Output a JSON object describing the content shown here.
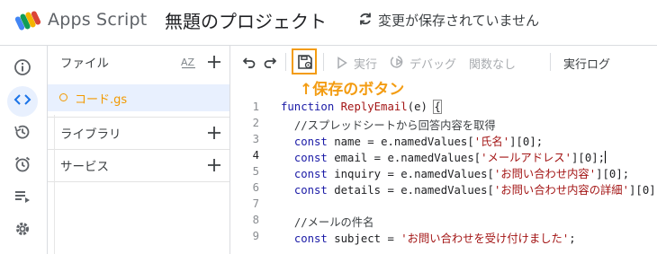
{
  "header": {
    "app_name": "Apps Script",
    "project_title": "無題のプロジェクト",
    "save_status": "変更が保存されていません"
  },
  "rail": {
    "items": [
      {
        "name": "overview-icon"
      },
      {
        "name": "editor-icon",
        "active": true
      },
      {
        "name": "history-icon"
      },
      {
        "name": "triggers-icon"
      },
      {
        "name": "executions-icon"
      },
      {
        "name": "settings-icon"
      }
    ]
  },
  "files": {
    "files_label": "ファイル",
    "file_items": [
      {
        "name": "コード.gs"
      }
    ],
    "libraries_label": "ライブラリ",
    "services_label": "サービス"
  },
  "toolbar": {
    "run_label": "実行",
    "debug_label": "デバッグ",
    "function_select": "関数なし",
    "exec_log_label": "実行ログ"
  },
  "annotation": {
    "text": "↑保存のボタン"
  },
  "editor": {
    "lines": [
      {
        "num": "1",
        "text": "function ReplyEmail(e) {"
      },
      {
        "num": "2",
        "text": "  //スプレッドシートから回答内容を取得"
      },
      {
        "num": "3",
        "text": "  const name = e.namedValues['氏名'][0];"
      },
      {
        "num": "4",
        "text": "  const email = e.namedValues['メールアドレス'][0];"
      },
      {
        "num": "5",
        "text": "  const inquiry = e.namedValues['お問い合わせ内容'][0];"
      },
      {
        "num": "6",
        "text": "  const details = e.namedValues['お問い合わせ内容の詳細'][0];"
      },
      {
        "num": "7",
        "text": ""
      },
      {
        "num": "8",
        "text": "  //メールの件名"
      },
      {
        "num": "9",
        "text": "  const subject = 'お問い合わせを受け付けました';"
      }
    ],
    "tokens": {
      "l1_kw": "function",
      "l1_fn": "ReplyEmail",
      "l1_rest": "(e) ",
      "l1_brace": "{",
      "l2_cm": "//スプレッドシートから回答内容を取得",
      "const": "const",
      "l3_pre": " name = e.namedValues[",
      "l3_str": "'氏名'",
      "l3_post": "][0];",
      "l4_pre": " email = e.namedValues[",
      "l4_str": "'メールアドレス'",
      "l4_post": "][0];",
      "l5_pre": " inquiry = e.namedValues[",
      "l5_str": "'お問い合わせ内容'",
      "l5_post": "][0];",
      "l6_pre": " details = e.namedValues[",
      "l6_str": "'お問い合わせ内容の詳細'",
      "l6_post": "][0];",
      "l8_cm": "//メールの件名",
      "l9_pre": " subject = ",
      "l9_str": "'お問い合わせを受け付けました'",
      "l9_post": ";"
    }
  },
  "colors": {
    "accent": "#1a73e8",
    "highlight": "#f39c12",
    "file_color": "#f29900"
  }
}
